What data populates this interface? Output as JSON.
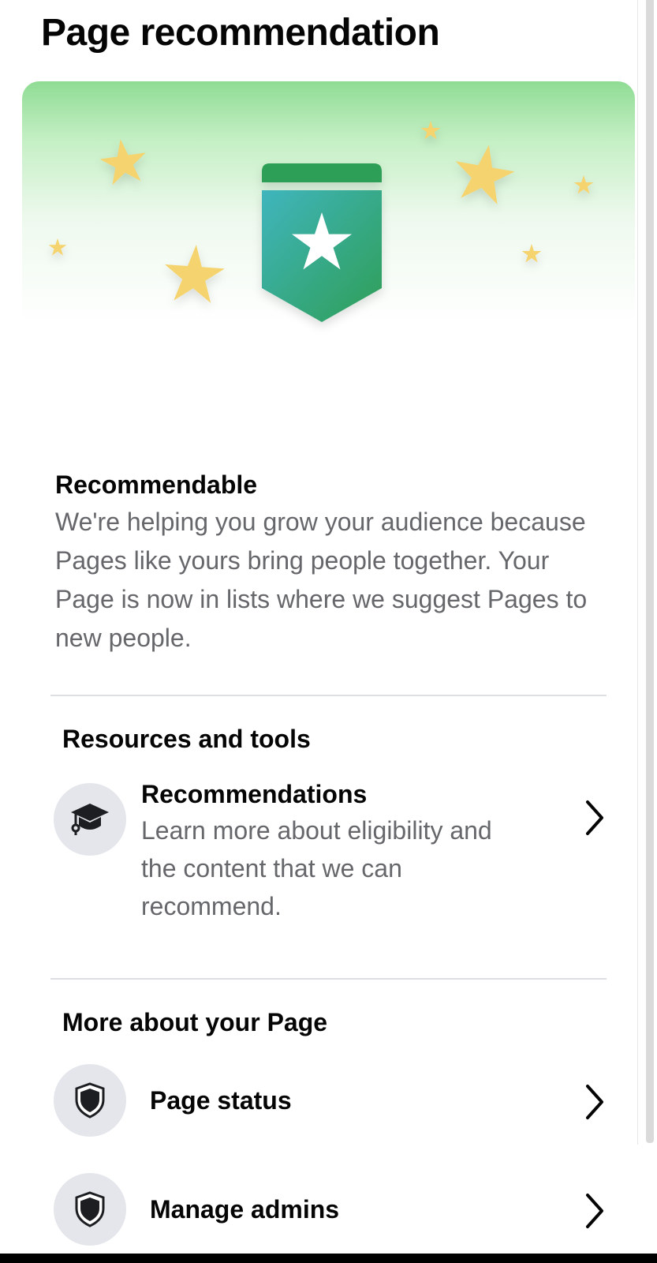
{
  "header": {
    "title": "Page recommendation"
  },
  "banner": {
    "icon": "star-badge-icon",
    "decorations": "star-icon",
    "colors": {
      "gradient_top": "#8fdc94",
      "badge_teal": "#3ab3a6",
      "badge_green": "#2e9f57",
      "star": "#f5d36e"
    }
  },
  "status": {
    "title": "Recommendable",
    "description": "We're helping you grow your audience because Pages like yours bring people together. Your Page is now in lists where we suggest Pages to new people."
  },
  "resources": {
    "heading": "Resources and tools",
    "items": [
      {
        "icon": "graduation-cap-icon",
        "title": "Recommendations",
        "description": "Learn more about eligibility and the content that we can recommend."
      }
    ]
  },
  "more": {
    "heading": "More about your Page",
    "items": [
      {
        "icon": "shield-icon",
        "title": "Page status"
      },
      {
        "icon": "shield-icon",
        "title": "Manage admins"
      }
    ]
  }
}
